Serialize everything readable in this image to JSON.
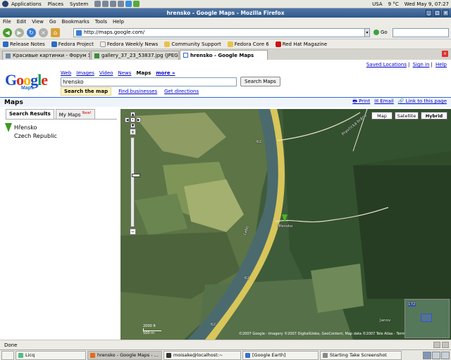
{
  "top_panel": {
    "menus": [
      "Applications",
      "Places",
      "System"
    ],
    "locale": "USA",
    "temperature": "9 °C",
    "clock": "Wed May  9, 07:27"
  },
  "window": {
    "title": "hrensko - Google Maps - Mozilla Firefox"
  },
  "menubar": [
    "File",
    "Edit",
    "View",
    "Go",
    "Bookmarks",
    "Tools",
    "Help"
  ],
  "navbar": {
    "url": "http://maps.google.com/",
    "go_label": "Go"
  },
  "bookmarks": [
    {
      "label": "Release Notes",
      "color": "#2b6cc4"
    },
    {
      "label": "Fedora Project",
      "color": "#2b6cc4"
    },
    {
      "label": "Fedora Weekly News",
      "color": "#dddddd"
    },
    {
      "label": "Community Support",
      "color": "#e8c34a"
    },
    {
      "label": "Fedora Core 6",
      "color": "#e8c34a"
    },
    {
      "label": "Red Hat Magazine",
      "color": "#cc1111"
    }
  ],
  "tabs": [
    {
      "label": "Красивые картинки - Форум 1..."
    },
    {
      "label": "gallery_37_23_53837.jpg (JPEG I..."
    },
    {
      "label": "hrensko - Google Maps"
    }
  ],
  "page": {
    "top_links": {
      "saved": "Saved Locations",
      "signin": "Sign in",
      "help": "Help"
    },
    "logo": {
      "text": "Google",
      "sub": "Maps"
    },
    "search_tabs": [
      "Web",
      "Images",
      "Video",
      "News",
      "Maps",
      "more »"
    ],
    "query": "hrensko",
    "search_button": "Search Maps",
    "sub_tabs": {
      "active": "Search the map",
      "businesses": "Find businesses",
      "directions": "Get directions"
    },
    "section_title": "Maps",
    "header_links": {
      "print": "Print",
      "email": "Email",
      "link": "Link to this page"
    },
    "panel_tabs": {
      "results": "Search Results",
      "mymaps": "My Maps",
      "new_badge": "New!"
    },
    "result": {
      "name": "Hřensko",
      "country": "Czech Republic"
    }
  },
  "map": {
    "types": {
      "map": "Map",
      "satellite": "Satellite",
      "hybrid": "Hybrid",
      "selected": "Hybrid"
    },
    "labels": {
      "road62a": "62",
      "road62b": "62",
      "road62c": "62",
      "town": "Hřensko",
      "place1": "Janov",
      "road172": "172",
      "river": "Labe",
      "road_n": "Pravčická brána"
    },
    "scale": {
      "top": "2000 ft",
      "bottom": "500 m"
    },
    "copyright": "©2007 Google - Imagery ©2007 DigitalGlobe, GeoContent, Map data ©2007 Tele Atlas - Terms of Use"
  },
  "status": {
    "text": "Done"
  },
  "taskbar": [
    {
      "label": "Licq",
      "color": "#5b8"
    },
    {
      "label": "hrensko - Google Maps - ...",
      "color": "#e66a1a"
    },
    {
      "label": "moisake@localhost:~",
      "color": "#333"
    },
    {
      "label": "[Google Earth]",
      "color": "#3a6fd0"
    },
    {
      "label": "Starting Take Screenshot",
      "color": "#888"
    }
  ]
}
